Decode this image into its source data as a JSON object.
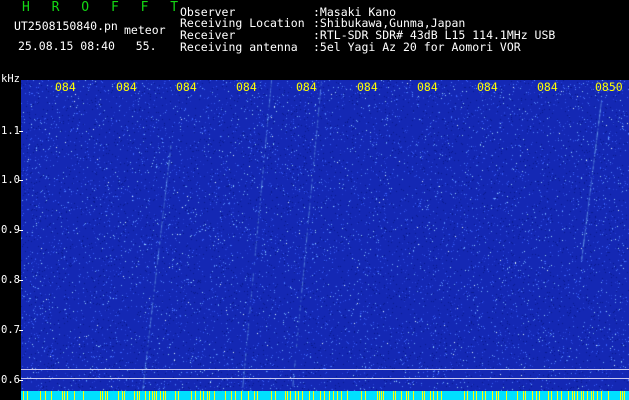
{
  "header": {
    "title": "H R O F F T",
    "filename": "UT2508150840.pn",
    "tag": "meteor",
    "date": "25.08.15 08:40",
    "seconds": "55.",
    "rows": [
      {
        "label": "Observer",
        "value": ":Masaki Kano"
      },
      {
        "label": "Receiving Location",
        "value": ":Shibukawa,Gunma,Japan"
      },
      {
        "label": "Receiver",
        "value": ":RTL-SDR SDR# 43dB L15 114.1MHz USB"
      },
      {
        "label": "Receiving antenna",
        "value": ":5el Yagi Az 20 for Aomori VOR"
      }
    ]
  },
  "yaxis": {
    "unit": "kHz",
    "ticks": [
      "1.1",
      "1.0",
      "0.9",
      "0.8",
      "0.7",
      "0.6"
    ]
  },
  "xaxis": {
    "ticks": [
      "084",
      "084",
      "084",
      "084",
      "084",
      "084",
      "084",
      "084",
      "084",
      "0850"
    ]
  },
  "colors": {
    "background": "#1428b4",
    "title": "#14d814",
    "ticks": "#ffff00",
    "footer": "#00e0ff"
  }
}
